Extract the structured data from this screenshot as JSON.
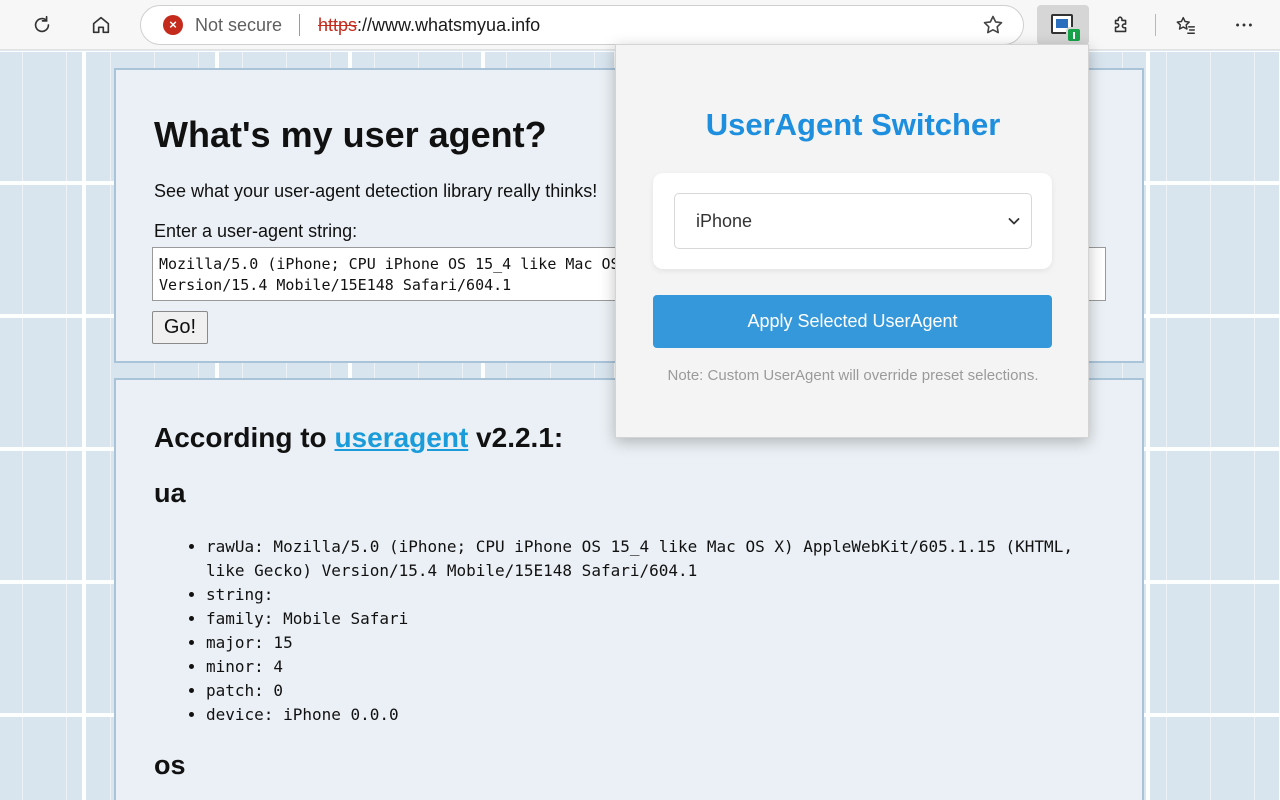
{
  "browser": {
    "not_secure_label": "Not secure",
    "url_protocol": "https",
    "url_rest": "://www.whatsmyua.info"
  },
  "page": {
    "title": "What's my user agent?",
    "tagline": "See what your user-agent detection library really thinks!",
    "input_label": "Enter a user-agent string:",
    "input_value": "Mozilla/5.0 (iPhone; CPU iPhone OS 15_4 like Mac OS X) AppleWebKit/605.1.15 (KHTML, like Gecko) Version/15.4 Mobile/15E148 Safari/604.1",
    "go_label": "Go!",
    "according_prefix": "According to ",
    "according_link": "useragent",
    "according_suffix": " v2.2.1:",
    "section_ua": "ua",
    "ua_items": [
      "rawUa: Mozilla/5.0 (iPhone; CPU iPhone OS 15_4 like Mac OS X) AppleWebKit/605.1.15 (KHTML, like Gecko) Version/15.4 Mobile/15E148 Safari/604.1",
      "string:",
      "family: Mobile Safari",
      "major: 15",
      "minor: 4",
      "patch: 0",
      "device: iPhone 0.0.0"
    ],
    "section_os": "os"
  },
  "popup": {
    "title": "UserAgent Switcher",
    "selected": "iPhone",
    "apply_label": "Apply Selected UserAgent",
    "note": "Note: Custom UserAgent will override preset selections."
  },
  "colors": {
    "popup_title": "#1e8fde",
    "apply_button": "#3498db",
    "link": "#1a9cdb",
    "not_secure": "#c42b1c"
  },
  "icons": [
    "refresh-icon",
    "home-icon",
    "not-secure-icon",
    "favorite-star-icon",
    "useragent-extension-icon",
    "extensions-puzzle-icon",
    "favorites-list-icon",
    "more-menu-icon",
    "chevron-down-icon"
  ]
}
